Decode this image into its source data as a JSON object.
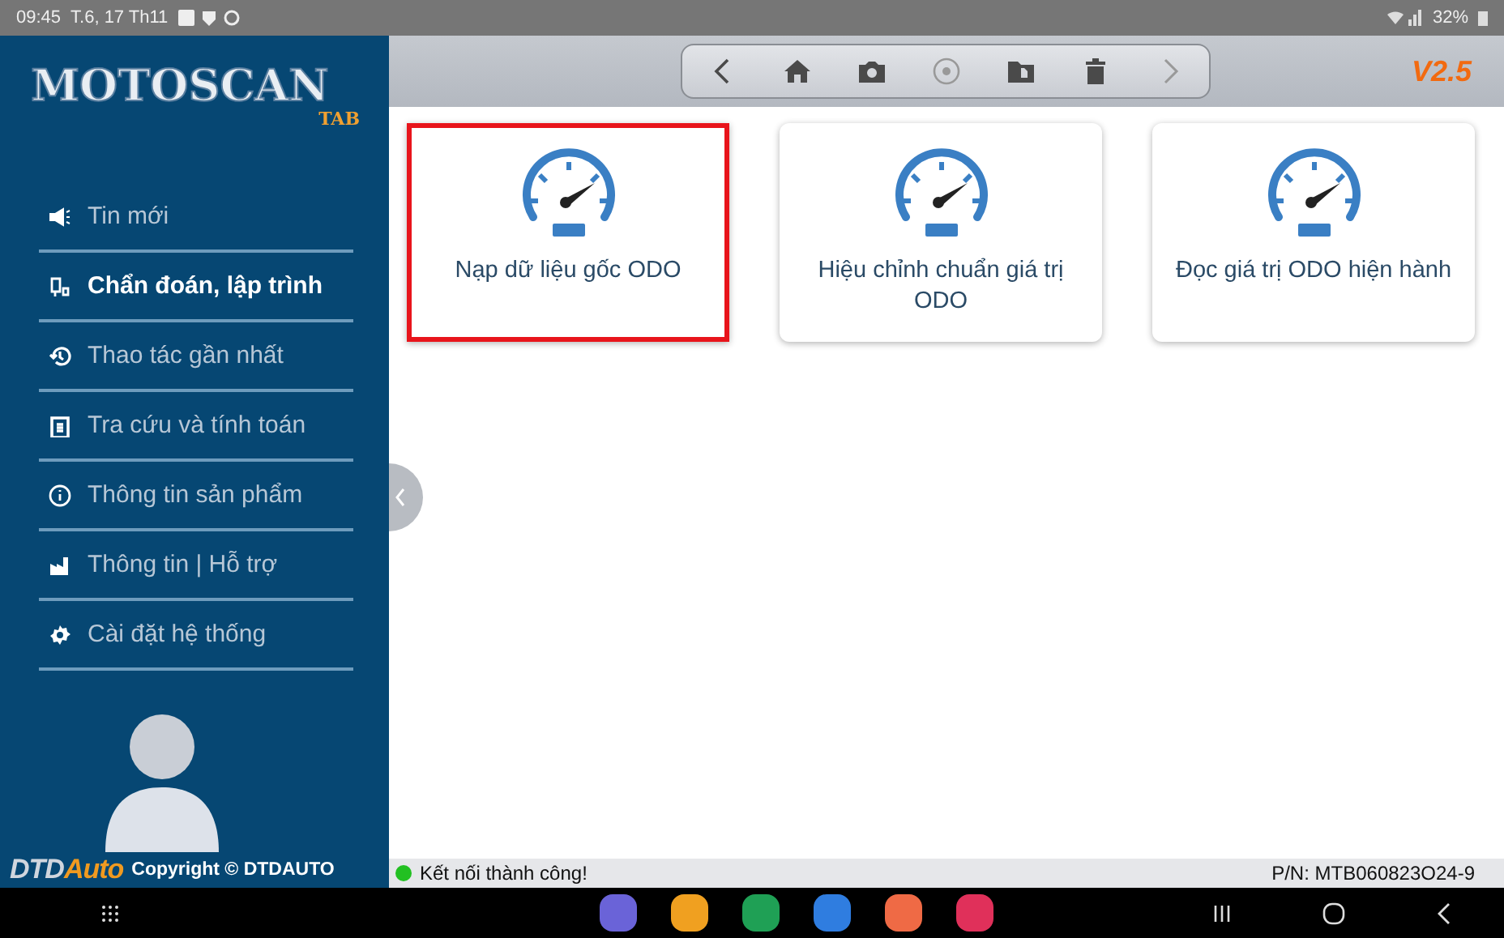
{
  "status_bar": {
    "time": "09:45",
    "date": "T.6, 17 Th11",
    "battery": "32%"
  },
  "sidebar": {
    "logo": "MOTOSCAN",
    "logo_sub": "TAB",
    "items": [
      {
        "label": "Tin mới",
        "selected": false
      },
      {
        "label": "Chẩn đoán, lập trình",
        "selected": true
      },
      {
        "label": "Thao tác gần nhất",
        "selected": false
      },
      {
        "label": "Tra cứu và tính toán",
        "selected": false
      },
      {
        "label": "Thông tin sản phẩm",
        "selected": false
      },
      {
        "label": "Thông tin | Hỗ trợ",
        "selected": false
      },
      {
        "label": "Cài đặt hệ thống",
        "selected": false
      }
    ],
    "brand_a": "DTD",
    "brand_b": "Auto",
    "copyright": "Copyright © DTDAUTO"
  },
  "toolbar": {
    "buttons": [
      {
        "kind": "back",
        "disabled": false
      },
      {
        "kind": "home",
        "disabled": false
      },
      {
        "kind": "camera",
        "disabled": false
      },
      {
        "kind": "record",
        "disabled": true
      },
      {
        "kind": "folder",
        "disabled": false
      },
      {
        "kind": "delete",
        "disabled": false
      },
      {
        "kind": "forward",
        "disabled": true
      }
    ],
    "version": "V2.5"
  },
  "cards": [
    {
      "label": "Nạp dữ liệu gốc ODO",
      "selected": true
    },
    {
      "label": "Hiệu chỉnh chuẩn giá trị ODO",
      "selected": false
    },
    {
      "label": "Đọc giá trị ODO hiện hành",
      "selected": false
    }
  ],
  "footer": {
    "connection": "Kết nối thành công!",
    "connected": true,
    "part_number": "P/N: MTB060823O24-9"
  },
  "taskbar": {
    "apps": [
      {
        "color": "#6a63d8"
      },
      {
        "color": "#f0a020"
      },
      {
        "color": "#1fa055"
      },
      {
        "color": "#2f7de0"
      },
      {
        "color": "#ef6a45"
      },
      {
        "color": "#e0305a"
      }
    ]
  }
}
